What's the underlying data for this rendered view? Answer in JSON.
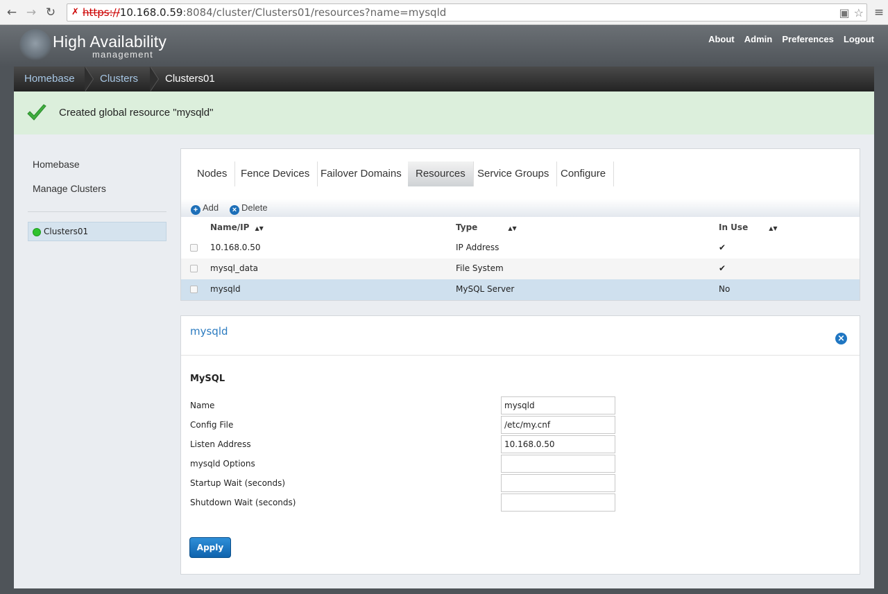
{
  "browser": {
    "url_scheme": "https://",
    "url_host": "10.168.0.59",
    "url_rest": ":8084/cluster/Clusters01/resources?name=mysqld"
  },
  "header": {
    "title": "High Availability",
    "subtitle": "management",
    "links": [
      "About",
      "Admin",
      "Preferences",
      "Logout"
    ]
  },
  "breadcrumb": {
    "items": [
      "Homebase",
      "Clusters",
      "Clusters01"
    ]
  },
  "notice": {
    "message": "Created global resource \"mysqld\""
  },
  "sidebar": {
    "links": [
      "Homebase",
      "Manage Clusters"
    ],
    "clusters": [
      {
        "name": "Clusters01",
        "status": "online"
      }
    ]
  },
  "tabs": {
    "items": [
      "Nodes",
      "Fence Devices",
      "Failover Domains",
      "Resources",
      "Service Groups",
      "Configure"
    ],
    "active": "Resources"
  },
  "toolbar": {
    "add_label": "Add",
    "delete_label": "Delete"
  },
  "table": {
    "columns": [
      "Name/IP",
      "Type",
      "In Use"
    ],
    "rows": [
      {
        "name": "10.168.0.50",
        "type": "IP Address",
        "in_use": "✔"
      },
      {
        "name": "mysql_data",
        "type": "File System",
        "in_use": "✔"
      },
      {
        "name": "mysqld",
        "type": "MySQL Server",
        "in_use": "No"
      }
    ]
  },
  "detail": {
    "title": "mysqld",
    "section": "MySQL",
    "fields": [
      {
        "label": "Name",
        "value": "mysqld"
      },
      {
        "label": "Config File",
        "value": "/etc/my.cnf"
      },
      {
        "label": "Listen Address",
        "value": "10.168.0.50"
      },
      {
        "label": "mysqld Options",
        "value": ""
      },
      {
        "label": "Startup Wait (seconds)",
        "value": ""
      },
      {
        "label": "Shutdown Wait (seconds)",
        "value": ""
      }
    ],
    "apply_label": "Apply"
  },
  "colors": {
    "accent": "#1f76c2",
    "success_bg": "#dcefdc",
    "status_online": "#2ec22e"
  }
}
